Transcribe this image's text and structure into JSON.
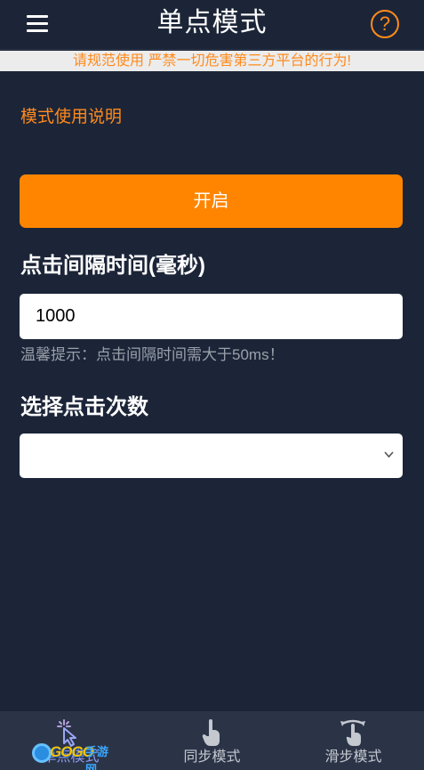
{
  "header": {
    "title": "单点模式",
    "help_symbol": "?"
  },
  "notice": "请规范使用 严禁一切危害第三方平台的行为!",
  "mode_help_link": "模式使用说明",
  "start_button": "开启",
  "interval": {
    "label": "点击间隔时间(毫秒)",
    "value": "1000",
    "hint": "温馨提示：点击间隔时间需大于50ms！"
  },
  "click_count": {
    "label": "选择点击次数",
    "selected": ""
  },
  "bottom_nav": [
    {
      "label": "单点模式",
      "icon": "tap-icon",
      "active": true
    },
    {
      "label": "同步模式",
      "icon": "hand-tap-icon",
      "active": false
    },
    {
      "label": "滑步模式",
      "icon": "swipe-icon",
      "active": false
    }
  ],
  "watermark": {
    "brand": "GOGO",
    "text": "手游网"
  },
  "colors": {
    "background": "#1c2538",
    "accent": "#ff8500",
    "nav_background": "#2b3447",
    "active_nav": "#8e9bf2"
  }
}
